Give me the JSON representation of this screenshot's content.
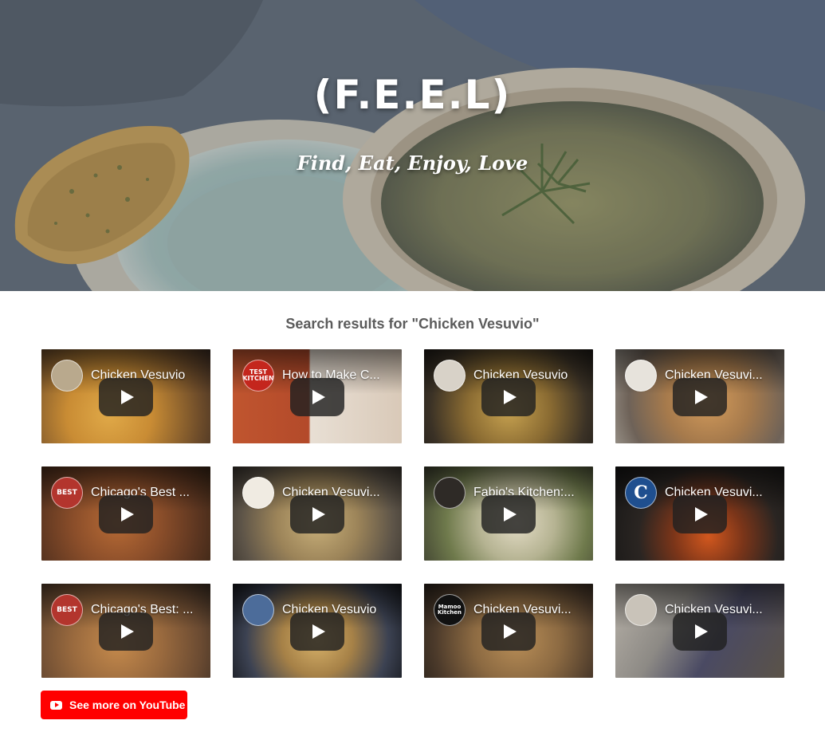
{
  "hero": {
    "title": "(F.E.E.L)",
    "tagline": "Find, Eat, Enjoy, Love"
  },
  "results": {
    "heading": "Search results for \"Chicken Vesuvio\"",
    "videos": [
      {
        "title": "Chicken Vesuvio",
        "avatar_text": "",
        "icon": "channel-avatar"
      },
      {
        "title": "How to Make C...",
        "avatar_text": "TEST KITCHEN",
        "icon": "test-kitchen-logo"
      },
      {
        "title": "Chicken Vesuvio",
        "avatar_text": "",
        "icon": "channel-avatar"
      },
      {
        "title": "Chicken Vesuvi...",
        "avatar_text": "",
        "icon": "channel-avatar"
      },
      {
        "title": "Chicago's Best ...",
        "avatar_text": "BEST",
        "icon": "chicagos-best-logo"
      },
      {
        "title": "Chicken Vesuvi...",
        "avatar_text": "",
        "icon": "channel-avatar"
      },
      {
        "title": "Fabio's Kitchen:...",
        "avatar_text": "",
        "icon": "channel-avatar"
      },
      {
        "title": "Chicken Vesuvi...",
        "avatar_text": "C",
        "icon": "chicago-tribune-logo"
      },
      {
        "title": "Chicago's Best: ...",
        "avatar_text": "BEST",
        "icon": "chicagos-best-logo"
      },
      {
        "title": "Chicken Vesuvio",
        "avatar_text": "",
        "icon": "channel-avatar"
      },
      {
        "title": "Chicken Vesuvi...",
        "avatar_text": "Mamoo Kitchen",
        "icon": "mamoo-kitchen-logo"
      },
      {
        "title": "Chicken Vesuvi...",
        "avatar_text": "",
        "icon": "channel-avatar"
      }
    ]
  },
  "youtube_button": {
    "label": "See more on YouTube",
    "icon": "youtube-icon"
  },
  "colors": {
    "youtube_red": "#ff0000",
    "heading_gray": "#5b5b5b"
  }
}
